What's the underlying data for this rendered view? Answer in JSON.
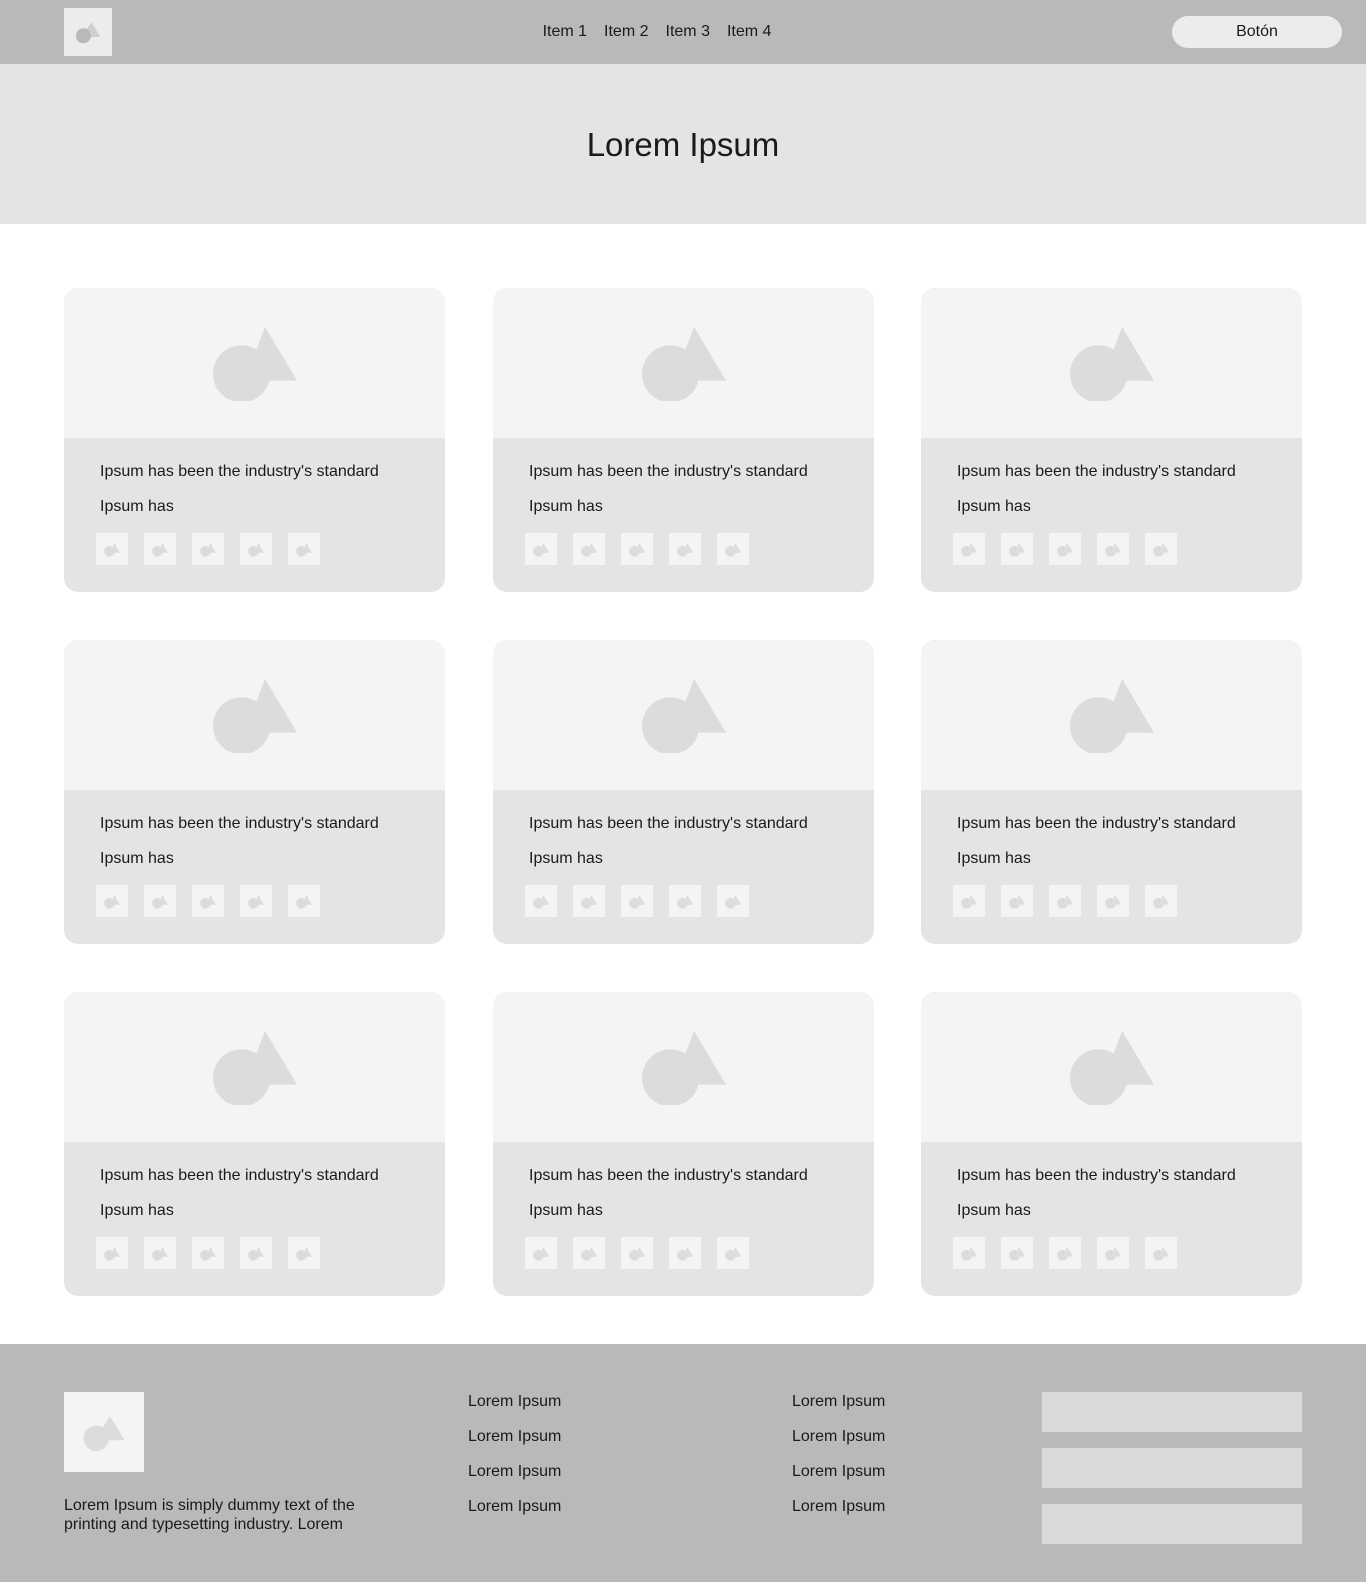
{
  "header": {
    "logo_icon": "image-placeholder-icon",
    "nav": [
      "Item 1",
      "Item 2",
      "Item 3",
      "Item 4"
    ],
    "button_label": "Botón"
  },
  "hero": {
    "title": "Lorem Ipsum"
  },
  "cards": [
    {
      "line1": "Ipsum has been the industry's standard",
      "line2": "Ipsum has"
    },
    {
      "line1": "Ipsum has been the industry's standard",
      "line2": "Ipsum has"
    },
    {
      "line1": "Ipsum has been the industry's standard",
      "line2": "Ipsum has"
    },
    {
      "line1": "Ipsum has been the industry's standard",
      "line2": "Ipsum has"
    },
    {
      "line1": "Ipsum has been the industry's standard",
      "line2": "Ipsum has"
    },
    {
      "line1": "Ipsum has been the industry's standard",
      "line2": "Ipsum has"
    },
    {
      "line1": "Ipsum has been the industry's standard",
      "line2": "Ipsum has"
    },
    {
      "line1": "Ipsum has been the industry's standard",
      "line2": "Ipsum has"
    },
    {
      "line1": "Ipsum has been the industry's standard",
      "line2": "Ipsum has"
    }
  ],
  "footer": {
    "description": "Lorem Ipsum is simply dummy text of the printing and typesetting industry. Lorem",
    "col1": [
      "Lorem Ipsum",
      "Lorem Ipsum",
      "Lorem Ipsum",
      "Lorem Ipsum"
    ],
    "col2": [
      "Lorem Ipsum",
      "Lorem Ipsum",
      "Lorem Ipsum",
      "Lorem Ipsum"
    ]
  },
  "colors": {
    "header_bg": "#b9b9b9",
    "hero_bg": "#e4e4e4",
    "card_bg": "#e4e4e4",
    "placeholder_bg": "#f4f4f4",
    "placeholder_shape": "#dcdcdc"
  }
}
